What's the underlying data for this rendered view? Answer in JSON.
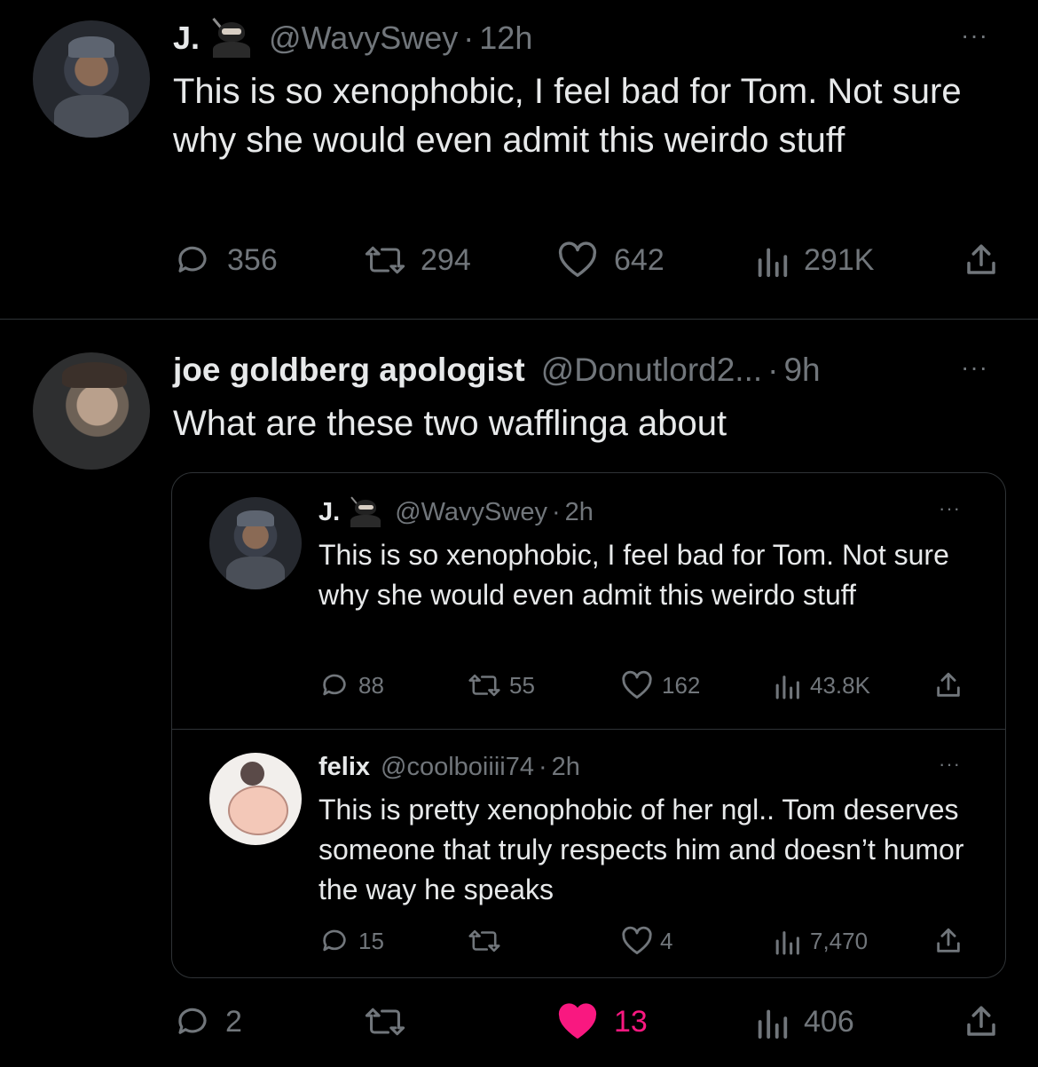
{
  "tweet1": {
    "name": "J.",
    "handle": "@WavySwey",
    "separator": "·",
    "time": "12h",
    "more": "···",
    "text": "This is so xenophobic, I feel bad for Tom. Not sure why she would even admit this weirdo stuff",
    "replies": "356",
    "retweets": "294",
    "likes": "642",
    "views": "291K"
  },
  "tweet2": {
    "name": "joe goldberg apologist",
    "handle": "@Donutlord2...",
    "separator": "·",
    "time": "9h",
    "more": "···",
    "text": "What are these two wafflinga about",
    "replies": "2",
    "retweets": "",
    "likes": "13",
    "views": "406"
  },
  "quote1": {
    "name": "J.",
    "handle": "@WavySwey",
    "separator": "·",
    "time": "2h",
    "more": "···",
    "text": "This is so xenophobic, I feel bad for Tom. Not sure why she would even admit this weirdo stuff",
    "replies": "88",
    "retweets": "55",
    "likes": "162",
    "views": "43.8K"
  },
  "quote2": {
    "name": "felix",
    "handle": "@coolboiiii74",
    "separator": "·",
    "time": "2h",
    "more": "···",
    "text": "This is pretty xenophobic of her ngl.. Tom deserves someone that truly respects him and doesn’t humor the way he speaks",
    "replies": "15",
    "retweets": "",
    "likes": "4",
    "views": "7,470"
  },
  "icons": {
    "reply": "reply-icon",
    "retweet": "retweet-icon",
    "like": "heart-icon",
    "views": "views-icon",
    "share": "share-icon",
    "ninja": "ninja-emoji-icon"
  },
  "colors": {
    "background": "#000000",
    "text": "#e7e9ea",
    "muted": "#71767b",
    "like_active": "#f91880",
    "border": "#2f3336"
  }
}
